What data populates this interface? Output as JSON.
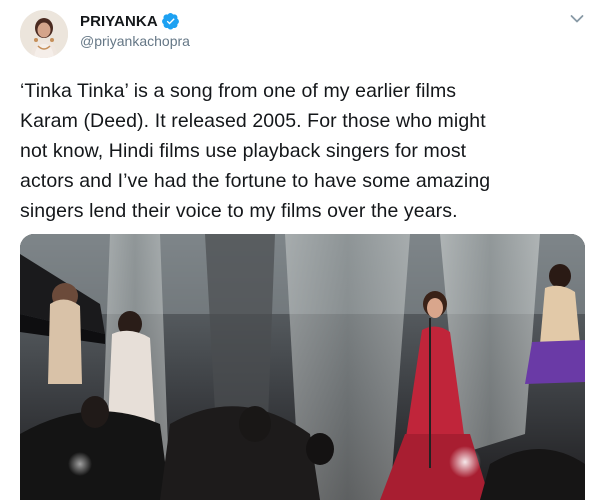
{
  "tweet": {
    "display_name": "PRIYANKA",
    "handle": "@priyankachopra",
    "text_lines": [
      "‘Tinka Tinka’ is a song from one of my earlier films",
      "Karam (Deed). It released 2005. For those who might",
      "not know, Hindi films use playback singers for most",
      "actors and I’ve had the fortune to have some amazing",
      "singers lend their voice to my films over the years."
    ],
    "verified": true,
    "media_kind": "video-still"
  },
  "icons": {
    "verified": "verified-badge-icon",
    "menu": "chevron-down-icon"
  },
  "colors": {
    "text": "#14171a",
    "secondary_text": "#657786",
    "verified_blue": "#1da1f2",
    "singer_dress": "#c0253a"
  }
}
